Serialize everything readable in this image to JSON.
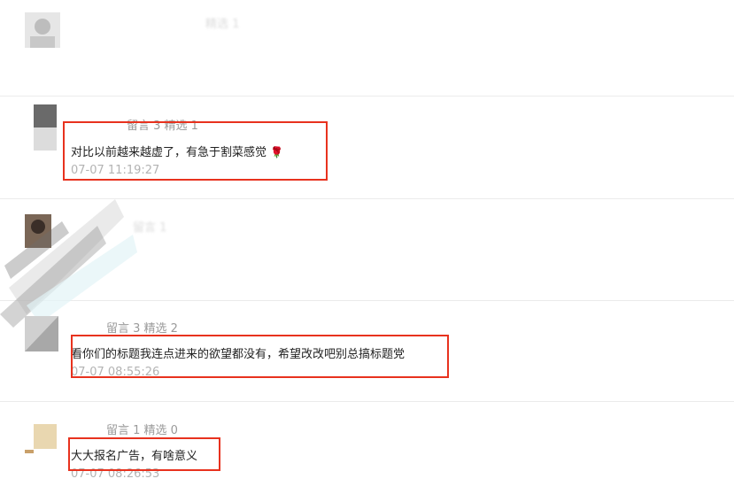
{
  "comments": [
    {
      "username": "",
      "stats": "精选 1",
      "text": "",
      "time": "",
      "faded": true
    },
    {
      "username": "",
      "stats": "留言 3   精选 1",
      "text": "对比以前越来越虚了，有急于割菜感觉",
      "rose": "🌹",
      "time": "07-07 11:19:27",
      "faded": false
    },
    {
      "username": "",
      "stats": "留言 1",
      "text": "",
      "time": "",
      "faded": true
    },
    {
      "username": "",
      "stats": "留言 3   精选 2",
      "text": "看你们的标题我连点进来的欲望都没有，希望改改吧别总搞标题党",
      "time": "07-07 08:55:26",
      "faded": false
    },
    {
      "username": "",
      "stats": "留言 1   精选 0",
      "text": "大大报名广告，有啥意义",
      "time": "07-07 08:26:53",
      "faded": false
    }
  ],
  "colors": {
    "highlight": "#e8321e",
    "meta": "#9a9a9a",
    "time": "#b3b3b3"
  }
}
